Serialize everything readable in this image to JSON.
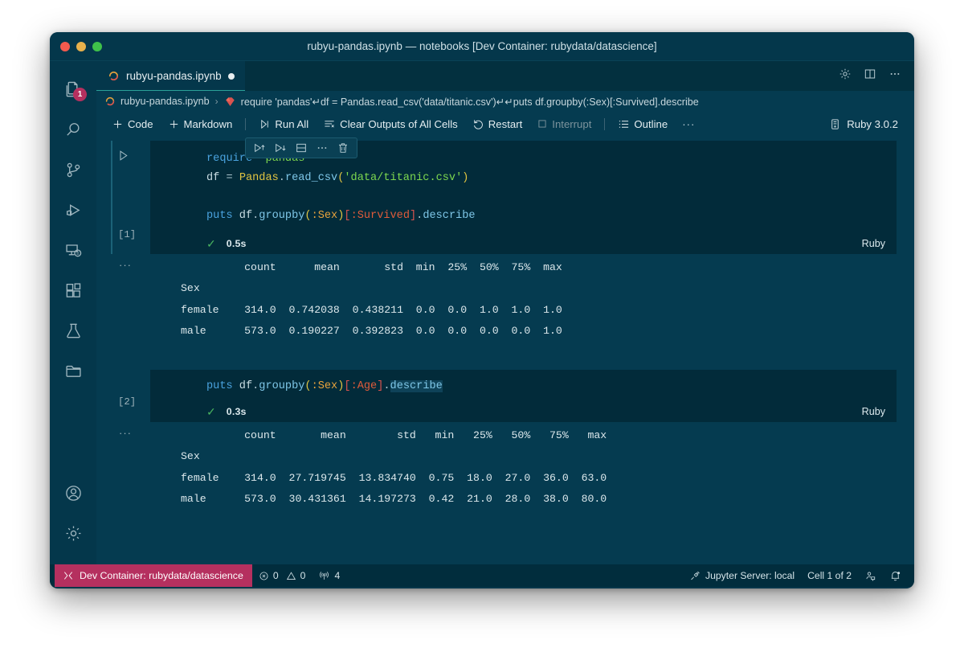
{
  "window": {
    "title": "rubyu-pandas.ipynb — notebooks [Dev Container: rubydata/datascience]"
  },
  "activitybar": {
    "items": [
      {
        "name": "explorer",
        "icon": "files-icon",
        "badge": "1"
      },
      {
        "name": "search",
        "icon": "search-icon",
        "badge": ""
      },
      {
        "name": "source-control",
        "icon": "source-control-icon",
        "badge": ""
      },
      {
        "name": "run-and-debug",
        "icon": "run-debug-icon",
        "badge": ""
      },
      {
        "name": "remote-explorer",
        "icon": "remote-explorer-icon",
        "badge": ""
      },
      {
        "name": "extensions",
        "icon": "extensions-icon",
        "badge": ""
      },
      {
        "name": "testing",
        "icon": "beaker-icon",
        "badge": ""
      },
      {
        "name": "folder",
        "icon": "folder-icon",
        "badge": ""
      }
    ],
    "bottom": [
      {
        "name": "accounts",
        "icon": "account-icon"
      },
      {
        "name": "manage-settings",
        "icon": "gear-icon"
      }
    ]
  },
  "tabs": {
    "active": {
      "label": "rubyu-pandas.ipynb",
      "dirty": true,
      "icon": "ruby-icon"
    },
    "actions": [
      {
        "name": "notebook-settings",
        "icon": "gear-icon"
      },
      {
        "name": "split-editor",
        "icon": "split-editor-icon"
      },
      {
        "name": "more-actions",
        "icon": "ellipsis-icon"
      }
    ]
  },
  "breadcrumb": {
    "file": "rubyu-pandas.ipynb",
    "separator": "›",
    "cell": "require 'pandas'↵df = Pandas.read_csv('data/titanic.csv')↵↵puts df.groupby(:Sex)[:Survived].describe"
  },
  "toolbar": {
    "add_code": "Code",
    "add_markdown": "Markdown",
    "run_all": "Run All",
    "clear_outputs": "Clear Outputs of All Cells",
    "restart": "Restart",
    "interrupt": "Interrupt",
    "outline": "Outline",
    "more": "···",
    "kernel": "Ruby 3.0.2"
  },
  "cell_toolbar": {
    "buttons": [
      {
        "name": "run-above-button",
        "icon": "run-above-icon"
      },
      {
        "name": "run-below-button",
        "icon": "run-below-icon"
      },
      {
        "name": "split-cell-button",
        "icon": "split-cell-icon"
      },
      {
        "name": "more-cell-actions-button",
        "icon": "ellipsis-icon"
      },
      {
        "name": "delete-cell-button",
        "icon": "trash-icon"
      }
    ]
  },
  "cells": [
    {
      "exec_label": "[1]",
      "status_icon": "check-icon",
      "duration": "0.5s",
      "language": "Ruby",
      "code_lines": [
        [
          {
            "t": "require",
            "c": "k-kw"
          },
          {
            "t": " ",
            "c": "k-plain"
          },
          {
            "t": "'pandas'",
            "c": "k-str"
          }
        ],
        [
          {
            "t": "df ",
            "c": "k-plain"
          },
          {
            "t": "=",
            "c": "k-op"
          },
          {
            "t": " ",
            "c": "k-plain"
          },
          {
            "t": "Pandas",
            "c": "k-const"
          },
          {
            "t": ".",
            "c": "k-punct"
          },
          {
            "t": "read_csv",
            "c": "k-fn"
          },
          {
            "t": "(",
            "c": "k-br"
          },
          {
            "t": "'data/titanic.csv'",
            "c": "k-str"
          },
          {
            "t": ")",
            "c": "k-br"
          }
        ],
        [],
        [
          {
            "t": "puts",
            "c": "k-kw"
          },
          {
            "t": " df",
            "c": "k-plain"
          },
          {
            "t": ".",
            "c": "k-punct"
          },
          {
            "t": "groupby",
            "c": "k-fn"
          },
          {
            "t": "(",
            "c": "k-br"
          },
          {
            "t": ":Sex",
            "c": "k-sym"
          },
          {
            "t": ")",
            "c": "k-br"
          },
          {
            "t": "[",
            "c": "k-br2"
          },
          {
            "t": ":Survived",
            "c": "k-sym2"
          },
          {
            "t": "]",
            "c": "k-br2"
          },
          {
            "t": ".",
            "c": "k-punct"
          },
          {
            "t": "describe",
            "c": "k-fn"
          }
        ]
      ],
      "output": {
        "ellipsis": "···",
        "lines": [
          "          count      mean       std  min  25%  50%  75%  max",
          "Sex                                                        ",
          "female    314.0  0.742038  0.438211  0.0  0.0  1.0  1.0  1.0",
          "male      573.0  0.190227  0.392823  0.0  0.0  0.0  0.0  1.0"
        ]
      }
    },
    {
      "exec_label": "[2]",
      "status_icon": "check-icon",
      "duration": "0.3s",
      "language": "Ruby",
      "code_lines": [
        [
          {
            "t": "puts",
            "c": "k-kw"
          },
          {
            "t": " df",
            "c": "k-plain"
          },
          {
            "t": ".",
            "c": "k-punct"
          },
          {
            "t": "groupby",
            "c": "k-fn"
          },
          {
            "t": "(",
            "c": "k-br"
          },
          {
            "t": ":Sex",
            "c": "k-sym"
          },
          {
            "t": ")",
            "c": "k-br"
          },
          {
            "t": "[",
            "c": "k-br2"
          },
          {
            "t": ":Age",
            "c": "k-sym2"
          },
          {
            "t": "]",
            "c": "k-br2"
          },
          {
            "t": ".",
            "c": "k-punct"
          },
          {
            "t": "describe",
            "c": "k-fn k-sel"
          }
        ]
      ],
      "output": {
        "ellipsis": "···",
        "lines": [
          "          count       mean        std   min   25%   50%   75%   max",
          "Sex                                                               ",
          "female    314.0  27.719745  13.834740  0.75  18.0  27.0  36.0  63.0",
          "male      573.0  30.431361  14.197273  0.42  21.0  28.0  38.0  80.0"
        ]
      }
    }
  ],
  "statusbar": {
    "remote": "Dev Container: rubydata/datascience",
    "errors": "0",
    "warnings": "0",
    "ports": "4",
    "jupyter_server": "Jupyter Server: local",
    "cell_position": "Cell 1 of 2"
  },
  "colors": {
    "accent_tab_underline": "#2aa198",
    "remote_badge": "#b5305f",
    "editor_bg": "#053b50",
    "code_bg": "#022b3a",
    "check_green": "#49b360"
  }
}
